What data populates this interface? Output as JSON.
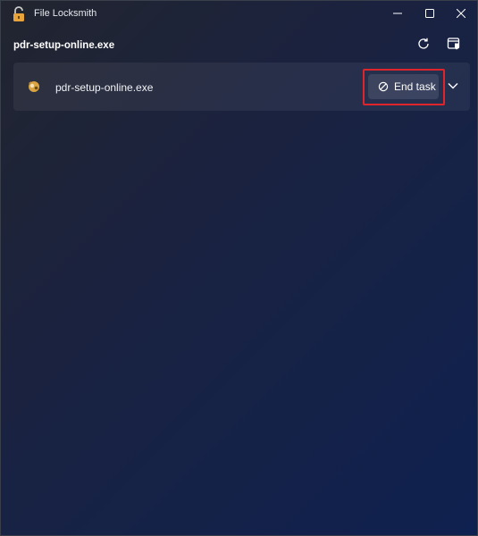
{
  "window": {
    "title": "File Locksmith"
  },
  "header": {
    "file_name": "pdr-setup-online.exe"
  },
  "processes": [
    {
      "name": "pdr-setup-online.exe",
      "action_label": "End task"
    }
  ],
  "icons": {
    "app": "lock-icon",
    "refresh": "refresh-icon",
    "admin": "shield-window-icon",
    "process": "process-icon",
    "end_task": "blocked-circle-icon",
    "expand": "chevron-down-icon"
  },
  "colors": {
    "highlight": "#e0242b",
    "accent_bg": "#0f2150"
  }
}
